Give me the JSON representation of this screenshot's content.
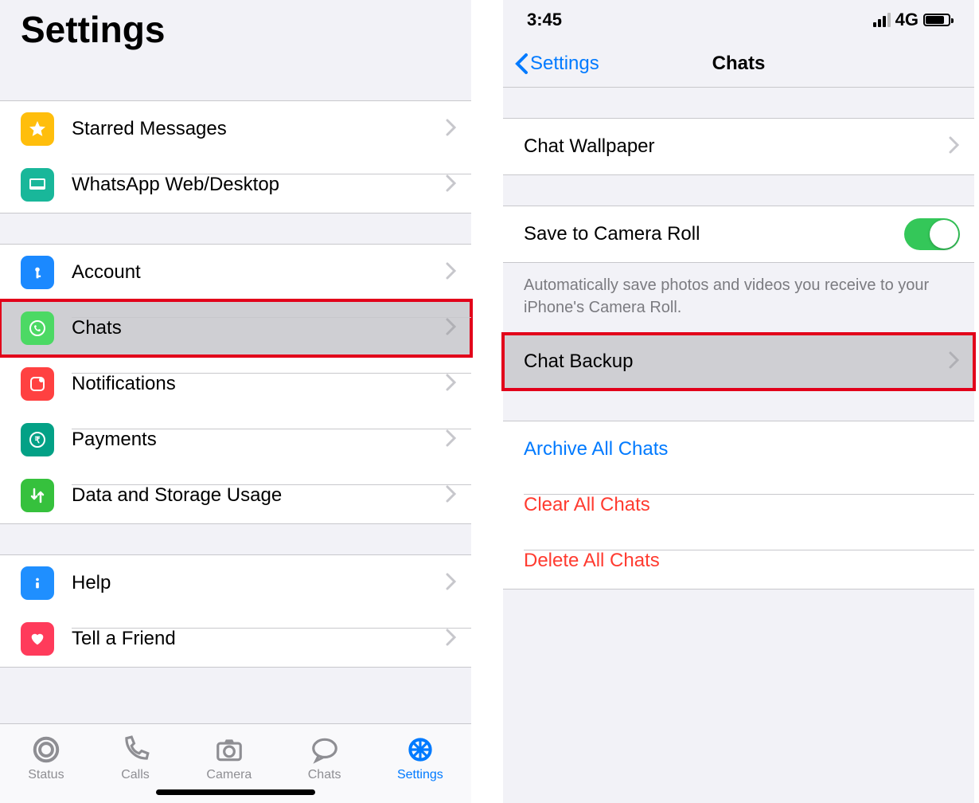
{
  "left": {
    "title": "Settings",
    "group1": [
      {
        "label": "Starred Messages",
        "icon": "star-icon"
      },
      {
        "label": "WhatsApp Web/Desktop",
        "icon": "desktop-icon"
      }
    ],
    "group2": [
      {
        "label": "Account",
        "icon": "key-icon"
      },
      {
        "label": "Chats",
        "icon": "whatsapp-icon",
        "highlighted": true
      },
      {
        "label": "Notifications",
        "icon": "notification-icon"
      },
      {
        "label": "Payments",
        "icon": "rupee-icon"
      },
      {
        "label": "Data and Storage Usage",
        "icon": "data-icon"
      }
    ],
    "group3": [
      {
        "label": "Help",
        "icon": "info-icon"
      },
      {
        "label": "Tell a Friend",
        "icon": "heart-icon"
      }
    ],
    "tabs": {
      "status": "Status",
      "calls": "Calls",
      "camera": "Camera",
      "chats": "Chats",
      "settings": "Settings"
    }
  },
  "right": {
    "status_time": "3:45",
    "status_network": "4G",
    "back_label": "Settings",
    "title": "Chats",
    "wallpaper": "Chat Wallpaper",
    "save_camera": "Save to Camera Roll",
    "save_camera_on": true,
    "footer": "Automatically save photos and videos you receive to your iPhone's Camera Roll.",
    "chat_backup": "Chat Backup",
    "archive": "Archive All Chats",
    "clear": "Clear All Chats",
    "delete": "Delete All Chats"
  }
}
